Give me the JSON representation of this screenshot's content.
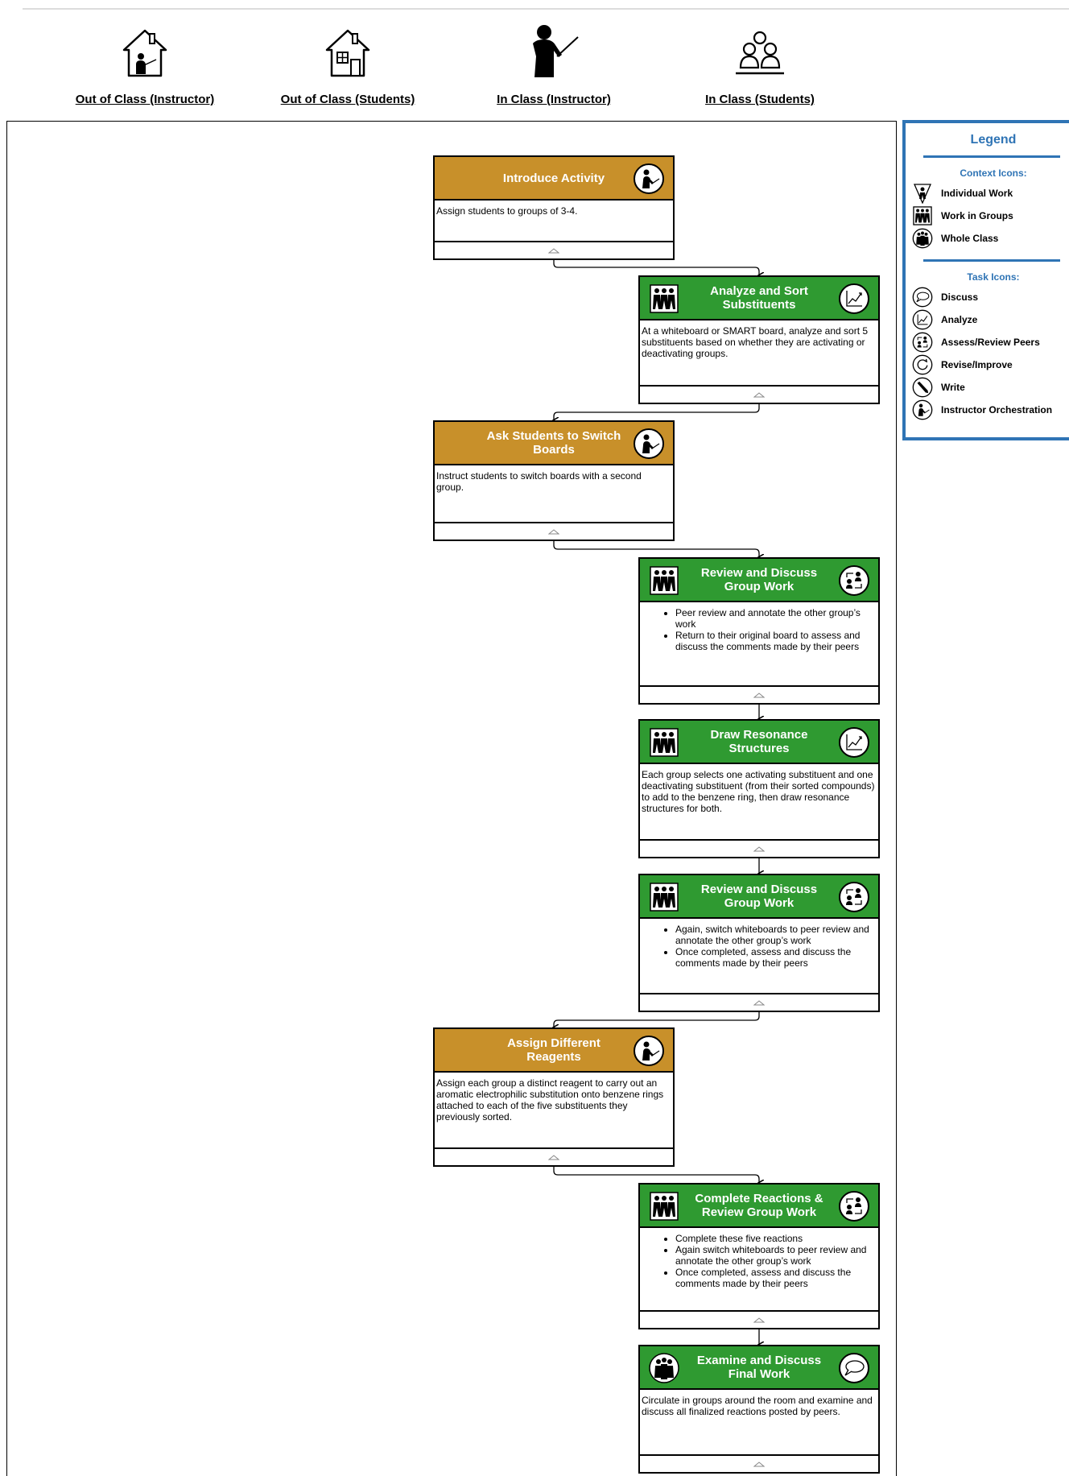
{
  "columns": [
    {
      "label": "Out of Class (Instructor)",
      "icon": "house-instructor-icon"
    },
    {
      "label": "Out of Class (Students)",
      "icon": "house-icon"
    },
    {
      "label": "In Class (Instructor)",
      "icon": "instructor-icon"
    },
    {
      "label": "In Class (Students)",
      "icon": "students-icon"
    }
  ],
  "cards": [
    {
      "title": "Introduce Activity",
      "type": "instructor",
      "task_icon": "instructor-orchestration-icon",
      "text": "Assign students to groups of 3-4."
    },
    {
      "title": "Analyze and Sort Substituents",
      "type": "group",
      "context_icon": "work-in-groups-icon",
      "task_icon": "analyze-icon",
      "text": "At a whiteboard or SMART board, analyze and sort 5 substituents based on whether they are activating or deactivating groups."
    },
    {
      "title": "Ask Students to Switch Boards",
      "type": "instructor",
      "task_icon": "instructor-orchestration-icon",
      "text": "Instruct students to switch boards with a second group."
    },
    {
      "title": "Review and Discuss Group Work",
      "type": "group",
      "context_icon": "work-in-groups-icon",
      "task_icon": "assess-review-peers-icon",
      "bullets": [
        "Peer review and annotate the other group’s work",
        "Return to their original board to assess and discuss the comments made by their peers"
      ]
    },
    {
      "title": "Draw Resonance Structures",
      "type": "group",
      "context_icon": "work-in-groups-icon",
      "task_icon": "analyze-icon",
      "text": "Each group selects one activating substituent and one deactivating substituent (from their sorted compounds) to add to the benzene ring, then draw resonance structures for both."
    },
    {
      "title": "Review and Discuss Group Work",
      "type": "group",
      "context_icon": "work-in-groups-icon",
      "task_icon": "assess-review-peers-icon",
      "bullets": [
        "Again, switch whiteboards to peer review and annotate the other group’s work",
        "Once completed, assess and discuss the comments made by their peers"
      ]
    },
    {
      "title": "Assign Different Reagents",
      "type": "instructor",
      "task_icon": "instructor-orchestration-icon",
      "text": "Assign each group a distinct reagent to carry out an aromatic electrophilic substitution onto benzene rings attached to each of the five substituents they previously sorted."
    },
    {
      "title": "Complete Reactions & Review Group Work",
      "type": "group",
      "context_icon": "work-in-groups-icon",
      "task_icon": "assess-review-peers-icon",
      "bullets": [
        "Complete these five reactions",
        "Again switch whiteboards to peer review and annotate the other group’s work",
        "Once completed, assess and discuss the comments made by their peers"
      ]
    },
    {
      "title": "Examine and Discuss Final Work",
      "type": "group",
      "context_icon": "whole-class-icon",
      "task_icon": "discuss-icon",
      "text": "Circulate in groups around the room and examine and discuss all finalized reactions posted by peers."
    }
  ],
  "legend": {
    "title": "Legend",
    "context_heading": "Context Icons:",
    "context_items": [
      {
        "label": "Individual Work",
        "icon": "individual-work-icon"
      },
      {
        "label": "Work in Groups",
        "icon": "work-in-groups-icon"
      },
      {
        "label": "Whole Class",
        "icon": "whole-class-icon"
      }
    ],
    "task_heading": "Task Icons:",
    "task_items": [
      {
        "label": "Discuss",
        "icon": "discuss-icon"
      },
      {
        "label": "Analyze",
        "icon": "analyze-icon"
      },
      {
        "label": "Assess/Review Peers",
        "icon": "assess-review-peers-icon"
      },
      {
        "label": "Revise/Improve",
        "icon": "revise-improve-icon"
      },
      {
        "label": "Write",
        "icon": "write-icon"
      },
      {
        "label": "Instructor Orchestration",
        "icon": "instructor-orchestration-icon"
      }
    ]
  },
  "colors": {
    "instructor": "#c8902a",
    "group": "#2f9a31",
    "legend_accent": "#2f74b5"
  }
}
